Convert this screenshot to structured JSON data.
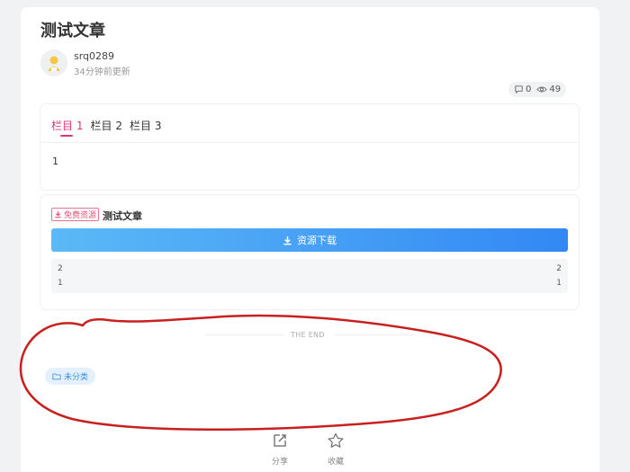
{
  "article": {
    "title": "测试文章",
    "author": "srq0289",
    "updated": "34分钟前更新",
    "comments": "0",
    "views": "49"
  },
  "tabs": {
    "items": [
      {
        "label": "栏目",
        "num": "1"
      },
      {
        "label": "栏目",
        "num": "2"
      },
      {
        "label": "栏目",
        "num": "3"
      }
    ],
    "content": "1"
  },
  "resource": {
    "badge": "免费资源",
    "title": "测试文章",
    "download_label": "资源下载",
    "info": {
      "left_top": "2",
      "left_bottom": "1",
      "right_top": "2",
      "right_bottom": "1"
    }
  },
  "footer": {
    "the_end": "THE END",
    "category": "未分类",
    "share_label": "分享",
    "favorite_label": "收藏"
  },
  "colors": {
    "accent_pink": "#d9387a",
    "button_blue_start": "#5cb9f6",
    "button_blue_end": "#3388f4",
    "annotation_red": "#c8201e"
  },
  "icons": {
    "avatar": "user-avatar",
    "comments": "comment-icon",
    "views": "eye-icon",
    "download": "download-icon",
    "folder": "folder-icon",
    "share": "share-icon",
    "favorite": "star-icon"
  }
}
